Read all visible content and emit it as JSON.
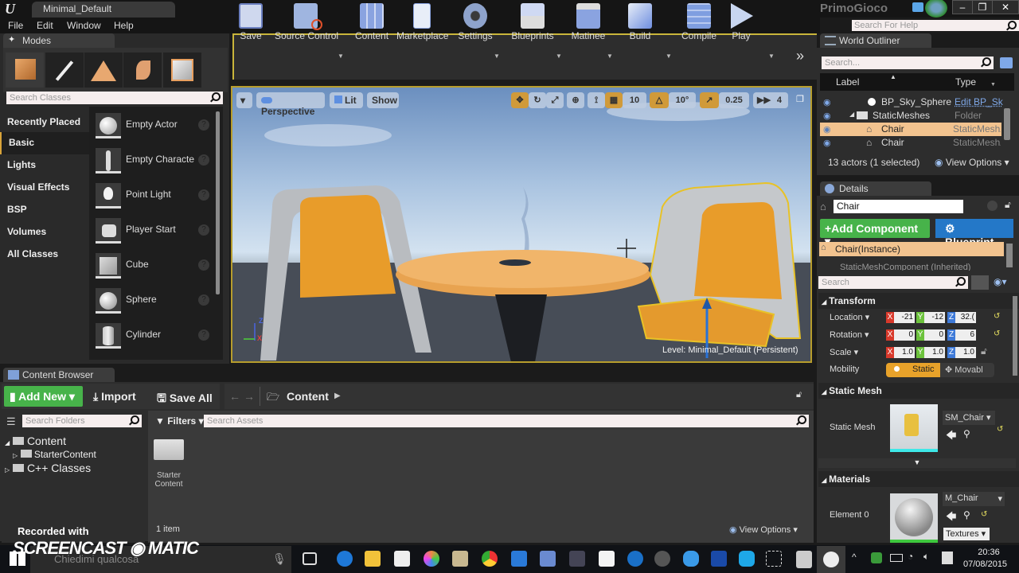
{
  "window": {
    "document_tab": "Minimal_Default",
    "project_name": "PrimoGioco",
    "help_search_placeholder": "Search For Help",
    "controls": [
      "minimize",
      "restore",
      "close"
    ]
  },
  "menu": [
    "File",
    "Edit",
    "Window",
    "Help"
  ],
  "modes_panel": {
    "tab": "Modes",
    "mode_icons": [
      "place-mode-icon",
      "paint-mode-icon",
      "landscape-mode-icon",
      "foliage-mode-icon",
      "geometry-mode-icon"
    ],
    "search_placeholder": "Search Classes",
    "categories": [
      "Recently Placed",
      "Basic",
      "Lights",
      "Visual Effects",
      "BSP",
      "Volumes",
      "All Classes"
    ],
    "selected_category": "Basic",
    "items": [
      "Empty Actor",
      "Empty Characte",
      "Point Light",
      "Player Start",
      "Cube",
      "Sphere",
      "Cylinder"
    ]
  },
  "toolbar": {
    "buttons": [
      {
        "label": "Save",
        "icon": "save-icon",
        "dropdown": false
      },
      {
        "label": "Source Control",
        "icon": "source-control-icon",
        "dropdown": true
      },
      {
        "label": "Content",
        "icon": "content-icon",
        "dropdown": false
      },
      {
        "label": "Marketplace",
        "icon": "marketplace-icon",
        "dropdown": false
      },
      {
        "label": "Settings",
        "icon": "settings-icon",
        "dropdown": true
      },
      {
        "label": "Blueprints",
        "icon": "blueprints-icon",
        "dropdown": true
      },
      {
        "label": "Matinee",
        "icon": "matinee-icon",
        "dropdown": true
      },
      {
        "label": "Build",
        "icon": "build-icon",
        "dropdown": true
      },
      {
        "label": "Compile",
        "icon": "compile-icon",
        "dropdown": false
      },
      {
        "label": "Play",
        "icon": "play-icon",
        "dropdown": true
      }
    ],
    "overflow": "»"
  },
  "viewport": {
    "view_mode": "Perspective",
    "lighting": "Lit",
    "show": "Show",
    "grid_snap": "10",
    "rotation_snap": "10°",
    "scale_snap": "0.25",
    "camera_speed": "4",
    "level_label": "Level:  Minimal_Default (Persistent)",
    "axis_labels": [
      "Z",
      "X"
    ]
  },
  "world_outliner": {
    "tab": "World Outliner",
    "search_placeholder": "Search...",
    "columns": [
      "Label",
      "Type"
    ],
    "rows": [
      {
        "label": "BP_Sky_Sphere",
        "type": "Edit BP_Sk",
        "selected": false,
        "link": true
      },
      {
        "label": "StaticMeshes",
        "type": "Folder",
        "selected": false,
        "folder": true
      },
      {
        "label": "Chair",
        "type": "StaticMeshA",
        "selected": true
      },
      {
        "label": "Chair",
        "type": "StaticMeshA",
        "selected": false
      }
    ],
    "status": "13 actors (1 selected)",
    "view_options": "View Options"
  },
  "details": {
    "tab": "Details",
    "name_value": "Chair",
    "add_component": "+Add Component",
    "blueprint": "Blueprint",
    "components": [
      "Chair(Instance)",
      "StaticMeshComponent (Inherited)"
    ],
    "search_placeholder": "Search",
    "transform": {
      "title": "Transform",
      "location": {
        "label": "Location",
        "x": "-21",
        "y": "-12",
        "z": "32.("
      },
      "rotation": {
        "label": "Rotation",
        "x": "0",
        "y": "0",
        "z": "6"
      },
      "scale": {
        "label": "Scale",
        "x": "1.0",
        "y": "1.0",
        "z": "1.0"
      },
      "mobility": {
        "label": "Mobility",
        "options": [
          "Static",
          "Movabl"
        ],
        "selected": "Static"
      }
    },
    "static_mesh": {
      "title": "Static Mesh",
      "label": "Static Mesh",
      "value": "SM_Chair"
    },
    "materials": {
      "title": "Materials",
      "label": "Element 0",
      "value": "M_Chair",
      "textures": "Textures"
    }
  },
  "content_browser": {
    "tab": "Content Browser",
    "add_new": "Add New",
    "import": "Import",
    "save_all": "Save All",
    "path": "Content",
    "search_folders_placeholder": "Search Folders",
    "filters": "Filters",
    "search_assets_placeholder": "Search Assets",
    "tree": [
      {
        "label": "Content",
        "level": 0,
        "expanded": true
      },
      {
        "label": "StarterContent",
        "level": 1
      },
      {
        "label": "C++ Classes",
        "level": 0
      }
    ],
    "assets": [
      "Starter\nContent"
    ],
    "item_count": "1 item",
    "view_options": "View Options"
  },
  "watermark": {
    "line1": "Recorded with",
    "line2": "SCREENCAST ◉ MATIC"
  },
  "taskbar": {
    "search_placeholder": "Chiedimi qualcosa",
    "time": "20:36",
    "date": "07/08/2015",
    "apps": [
      "task-view",
      "edge",
      "file-explorer",
      "store",
      "app-color",
      "app-map",
      "chrome",
      "outlook",
      "app-paint",
      "app-camera",
      "app-grid",
      "app-blue-circle",
      "app-dark",
      "app-shield",
      "malwarebytes",
      "skype",
      "snipping",
      "epic-launcher",
      "unreal-editor"
    ]
  }
}
